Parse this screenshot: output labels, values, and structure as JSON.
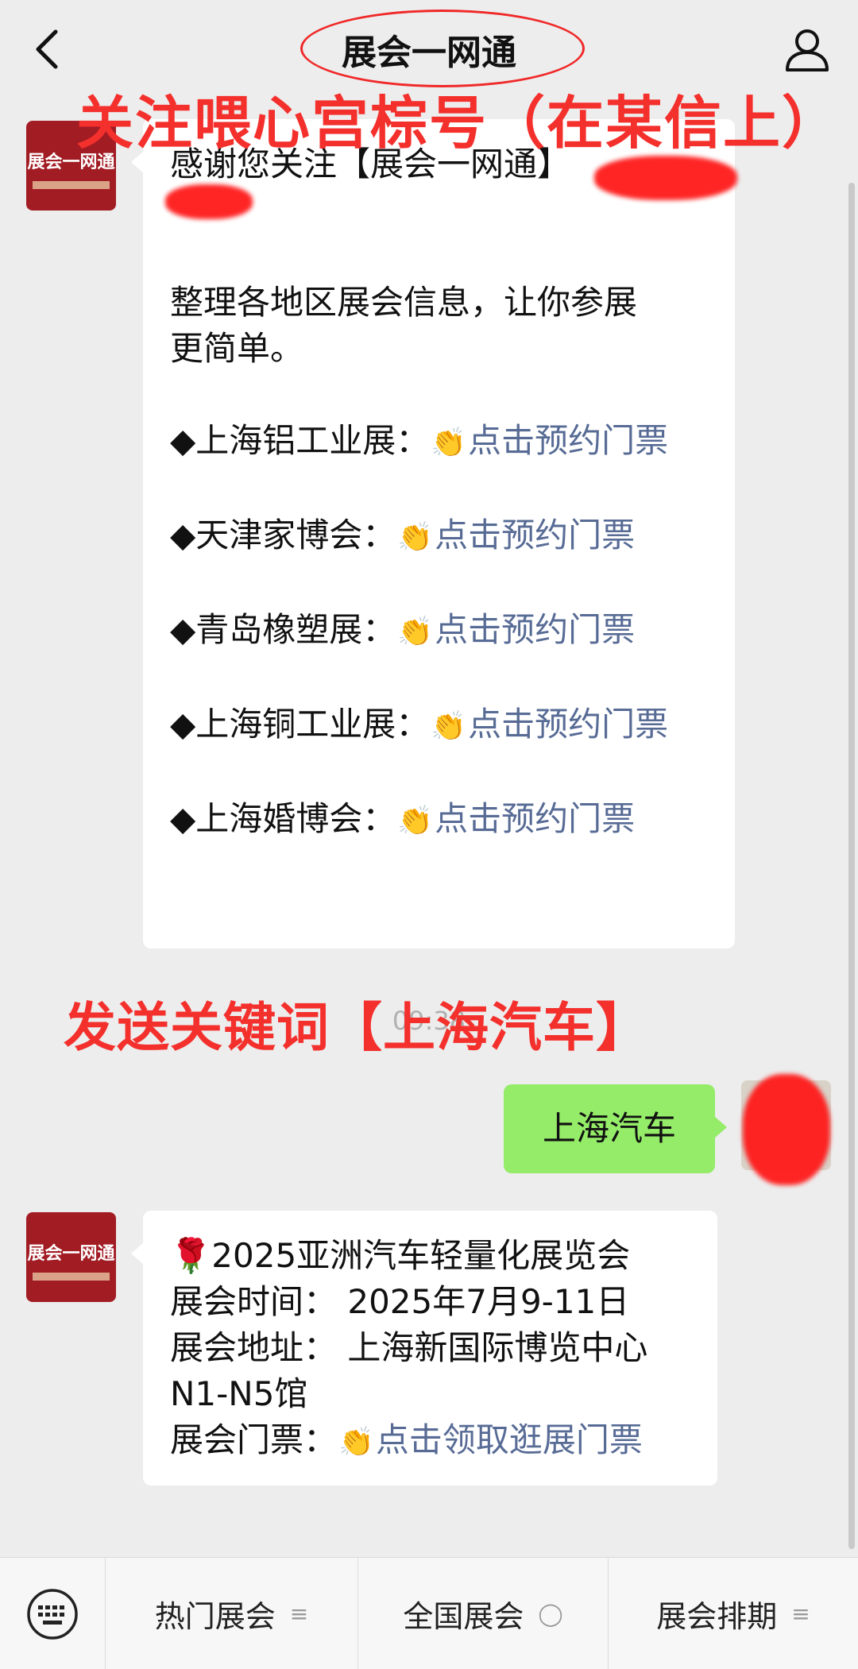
{
  "header": {
    "title": "展会一网通",
    "back_icon": "chevron-left-icon",
    "profile_icon": "person-icon"
  },
  "annotations": {
    "top": "关注喂心宫棕号（在某信上）",
    "middle": "发送关键词【上海汽车】"
  },
  "avatar": {
    "label": "展会一网通",
    "color": "#a21c24"
  },
  "message_1": {
    "greeting": "感谢您关注【展会一网通】",
    "intro_line1": "整理各地区展会信息，让你参展",
    "intro_line2": "更简单。",
    "items": [
      {
        "prefix": "◆上海铝工业展：",
        "link": "点击预约门票"
      },
      {
        "prefix": "◆天津家博会：",
        "link": "点击预约门票"
      },
      {
        "prefix": "◆青岛橡塑展：",
        "link": "点击预约门票"
      },
      {
        "prefix": "◆上海铜工业展：",
        "link": "点击预约门票"
      },
      {
        "prefix": "◆上海婚博会：",
        "link": "点击预约门票"
      }
    ]
  },
  "timestamp": "09:38",
  "user_message": "上海汽车",
  "message_2": {
    "title": "2025亚洲汽车轻量化展览会",
    "time_line": "展会时间：  2025年7月9-11日",
    "address_line1": "展会地址：  上海新国际博览中心",
    "address_line2": "N1-N5馆",
    "ticket_prefix": "展会门票：",
    "ticket_link": "点击领取逛展门票"
  },
  "bottom_menu": {
    "keyboard_icon": "keyboard-icon",
    "tabs": [
      {
        "label": "热门展会",
        "icon": "≡"
      },
      {
        "label": "全国展会",
        "icon": "◯"
      },
      {
        "label": "展会排期",
        "icon": "≡"
      }
    ]
  },
  "colors": {
    "link": "#576b95",
    "annotation": "#f4302d",
    "user_bubble": "#95ec69",
    "background": "#ededed"
  }
}
